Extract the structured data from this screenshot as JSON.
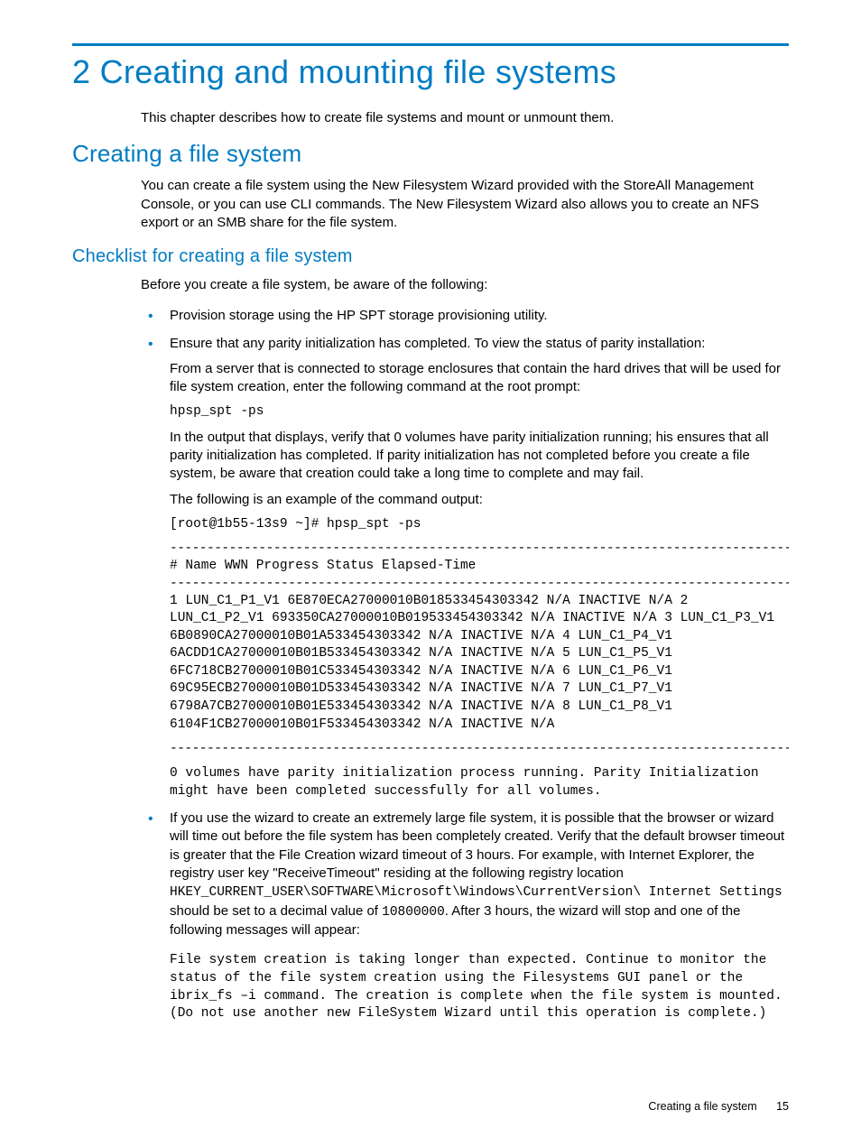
{
  "chapter": {
    "title": "2 Creating and mounting file systems",
    "intro": "This chapter describes how to create file systems and mount or unmount them."
  },
  "section1": {
    "title": "Creating a file system",
    "intro": "You can create a file system using the New Filesystem Wizard provided with the StoreAll Management Console, or you can use CLI commands. The New Filesystem Wizard also allows you to create an NFS export or an SMB share for the file system."
  },
  "subsection": {
    "title": "Checklist for creating a file system",
    "intro": "Before you create a file system, be aware of the following:"
  },
  "bullet1": "Provision storage using the HP SPT storage provisioning utility.",
  "bullet2": {
    "lead": "Ensure that any parity initialization has completed. To view the status of parity installation:",
    "para1": "From a server that is connected to storage enclosures that contain the hard drives that will be used for file system creation, enter the following command at the root prompt:",
    "cmd1": "hpsp_spt -ps",
    "para2": "In the output that displays, verify that 0 volumes have parity initialization running; his ensures that all parity initialization has completed. If parity initialization has not completed before you create a file system, be aware that creation could take a long time to complete and may fail.",
    "para3": "The following is an example of the command output:",
    "cmd2": "[root@1b55-13s9 ~]# hpsp_spt -ps",
    "dash": "----------------------------------------------------------------------------------------------",
    "hdr": "# Name WWN Progress Status Elapsed-Time",
    "output": "1 LUN_C1_P1_V1 6E870ECA27000010B018533454303342 N/A INACTIVE N/A 2 LUN_C1_P2_V1 693350CA27000010B019533454303342 N/A INACTIVE N/A 3 LUN_C1_P3_V1 6B0890CA27000010B01A533454303342 N/A INACTIVE N/A 4 LUN_C1_P4_V1 6ACDD1CA27000010B01B533454303342 N/A INACTIVE N/A 5 LUN_C1_P5_V1 6FC718CB27000010B01C533454303342 N/A INACTIVE N/A 6 LUN_C1_P6_V1 69C95ECB27000010B01D533454303342 N/A INACTIVE N/A 7 LUN_C1_P7_V1 6798A7CB27000010B01E533454303342 N/A INACTIVE N/A 8 LUN_C1_P8_V1 6104F1CB27000010B01F533454303342 N/A INACTIVE N/A",
    "tail": "0 volumes have parity initialization process running. Parity Initialization might have been completed successfully for all volumes."
  },
  "bullet3": {
    "t1": "If you use the wizard to create an extremely large file system, it is possible that the browser or wizard will time out before the file system has been completely created. Verify that the default browser timeout is greater that the File Creation wizard timeout of 3 hours. For example, with Internet Explorer, the registry user key \"ReceiveTimeout\" residing at the following registry location ",
    "c1": "HKEY_CURRENT_USER\\SOFTWARE\\Microsoft\\Windows\\CurrentVersion\\ Internet Settings",
    "t2": " should be set to a decimal value of ",
    "c2": "10800000",
    "t3": ". After 3 hours, the wizard will stop and one of the following messages will appear:",
    "msg": "File system creation is taking longer than expected. Continue to monitor the status of the file system creation using the Filesystems GUI panel or the ibrix_fs –i command. The creation is complete when the file system is mounted. (Do not use another new FileSystem Wizard until this operation is complete.)"
  },
  "footer": {
    "label": "Creating a file system",
    "page": "15"
  }
}
